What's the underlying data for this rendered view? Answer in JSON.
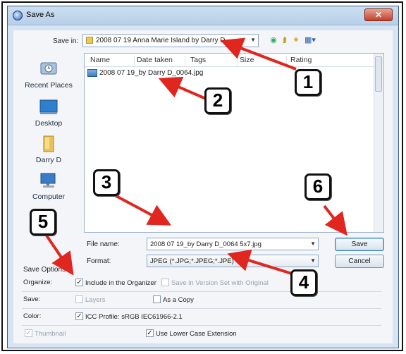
{
  "window": {
    "title": "Save As"
  },
  "toolbar": {
    "save_in_label": "Save in:",
    "save_in_value": "2008 07 19 Anna Marie Island by Darry D"
  },
  "places": [
    {
      "label": "Recent Places",
      "icon": "recent-places-icon"
    },
    {
      "label": "Desktop",
      "icon": "desktop-icon"
    },
    {
      "label": "Darry D",
      "icon": "user-folder-icon"
    },
    {
      "label": "Computer",
      "icon": "computer-icon"
    }
  ],
  "columns": [
    "Name",
    "Date taken",
    "Tags",
    "Size",
    "Rating"
  ],
  "files": [
    {
      "name": "2008 07 19_by Darry D_0064.jpg"
    }
  ],
  "form": {
    "file_name_label": "File name:",
    "file_name_value": "2008 07 19_by Darry D_0064 5x7.jpg",
    "format_label": "Format:",
    "format_value": "JPEG (*.JPG;*.JPEG;*.JPE)"
  },
  "buttons": {
    "save": "Save",
    "cancel": "Cancel"
  },
  "save_options": {
    "title": "Save Options",
    "organize_label": "Organize:",
    "include_organizer": "Include in the Organizer",
    "save_version_set": "Save in Version Set with Original",
    "save_label": "Save:",
    "layers": "Layers",
    "as_copy": "As a Copy",
    "color_label": "Color:",
    "icc_profile": "ICC Profile:  sRGB IEC61966-2.1",
    "thumbnail": "Thumbnail",
    "lower_case": "Use Lower Case Extension"
  },
  "callouts": [
    "1",
    "2",
    "3",
    "4",
    "5",
    "6"
  ],
  "colors": {
    "arrow": "#e0261f",
    "title_bar": "#c5d9ee",
    "dialog_bg": "#f3f5f9"
  }
}
